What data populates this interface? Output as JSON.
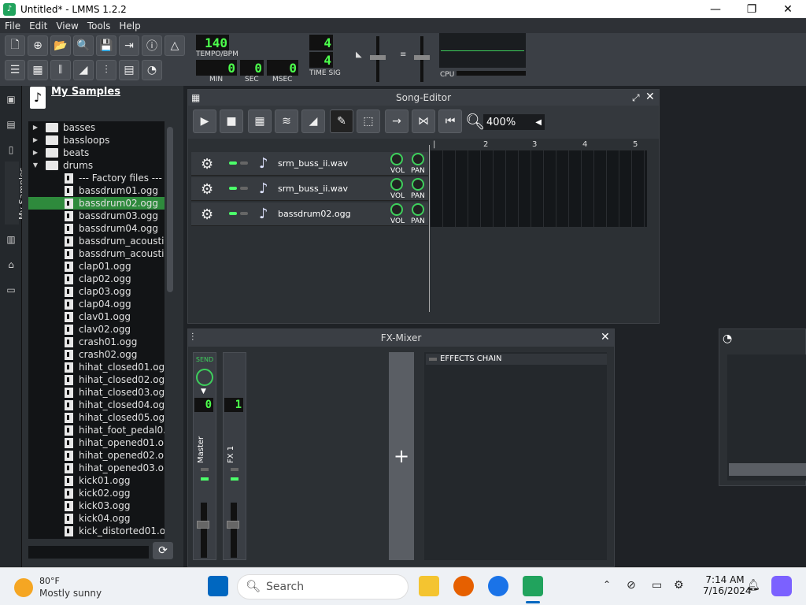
{
  "window": {
    "title": "Untitled* - LMMS 1.2.2",
    "app_icon": "lmms-icon",
    "controls": [
      "—",
      "❐",
      "✕"
    ]
  },
  "menu": [
    "File",
    "Edit",
    "View",
    "Tools",
    "Help"
  ],
  "toolbar": {
    "tempo": "140",
    "tempo_label": "TEMPO/BPM",
    "min": "0",
    "sec": "0",
    "msec": "0",
    "min_label": "MIN",
    "sec_label": "SEC",
    "msec_label": "MSEC",
    "timesig_num": "4",
    "timesig_den": "4",
    "timesig_label": "TIME SIG",
    "cpu_label": "CPU"
  },
  "samples_panel": {
    "title": "My Samples",
    "tab_label": "My Samples",
    "items": [
      {
        "label": "basses",
        "type": "folder",
        "expanded": false
      },
      {
        "label": "bassloops",
        "type": "folder",
        "expanded": false
      },
      {
        "label": "beats",
        "type": "folder",
        "expanded": false
      },
      {
        "label": "drums",
        "type": "folder",
        "expanded": true
      },
      {
        "label": "--- Factory files ---",
        "type": "factory"
      },
      {
        "label": "bassdrum01.ogg",
        "type": "file"
      },
      {
        "label": "bassdrum02.ogg",
        "type": "file",
        "selected": true
      },
      {
        "label": "bassdrum03.ogg",
        "type": "file"
      },
      {
        "label": "bassdrum04.ogg",
        "type": "file"
      },
      {
        "label": "bassdrum_acousti...",
        "type": "file"
      },
      {
        "label": "bassdrum_acousti...",
        "type": "file"
      },
      {
        "label": "clap01.ogg",
        "type": "file"
      },
      {
        "label": "clap02.ogg",
        "type": "file"
      },
      {
        "label": "clap03.ogg",
        "type": "file"
      },
      {
        "label": "clap04.ogg",
        "type": "file"
      },
      {
        "label": "clav01.ogg",
        "type": "file"
      },
      {
        "label": "clav02.ogg",
        "type": "file"
      },
      {
        "label": "crash01.ogg",
        "type": "file"
      },
      {
        "label": "crash02.ogg",
        "type": "file"
      },
      {
        "label": "hihat_closed01.ogg",
        "type": "file"
      },
      {
        "label": "hihat_closed02.ogg",
        "type": "file"
      },
      {
        "label": "hihat_closed03.ogg",
        "type": "file"
      },
      {
        "label": "hihat_closed04.ogg",
        "type": "file"
      },
      {
        "label": "hihat_closed05.ogg",
        "type": "file"
      },
      {
        "label": "hihat_foot_pedal0...",
        "type": "file"
      },
      {
        "label": "hihat_opened01.o...",
        "type": "file"
      },
      {
        "label": "hihat_opened02.o...",
        "type": "file"
      },
      {
        "label": "hihat_opened03.o...",
        "type": "file"
      },
      {
        "label": "kick01.ogg",
        "type": "file"
      },
      {
        "label": "kick02.ogg",
        "type": "file"
      },
      {
        "label": "kick03.ogg",
        "type": "file"
      },
      {
        "label": "kick04.ogg",
        "type": "file"
      },
      {
        "label": "kick_distorted01.o...",
        "type": "file"
      }
    ]
  },
  "song_editor": {
    "title": "Song-Editor",
    "zoom": "400%",
    "timeline": [
      "2",
      "3",
      "4",
      "5"
    ],
    "tracks": [
      {
        "name": "srm_buss_ii.wav"
      },
      {
        "name": "srm_buss_ii.wav"
      },
      {
        "name": "bassdrum02.ogg"
      }
    ],
    "vol_label": "VOL",
    "pan_label": "PAN"
  },
  "fx_mixer": {
    "title": "FX-Mixer",
    "send_label": "SEND",
    "channels": [
      {
        "name": "Master",
        "num": "0"
      },
      {
        "name": "FX 1",
        "num": "1"
      }
    ],
    "effects_label": "EFFECTS CHAIN",
    "add_label": "+"
  },
  "taskbar": {
    "weather_temp": "80°F",
    "weather_desc": "Mostly sunny",
    "search_placeholder": "Search",
    "time": "7:14 AM",
    "date": "7/16/2024"
  }
}
